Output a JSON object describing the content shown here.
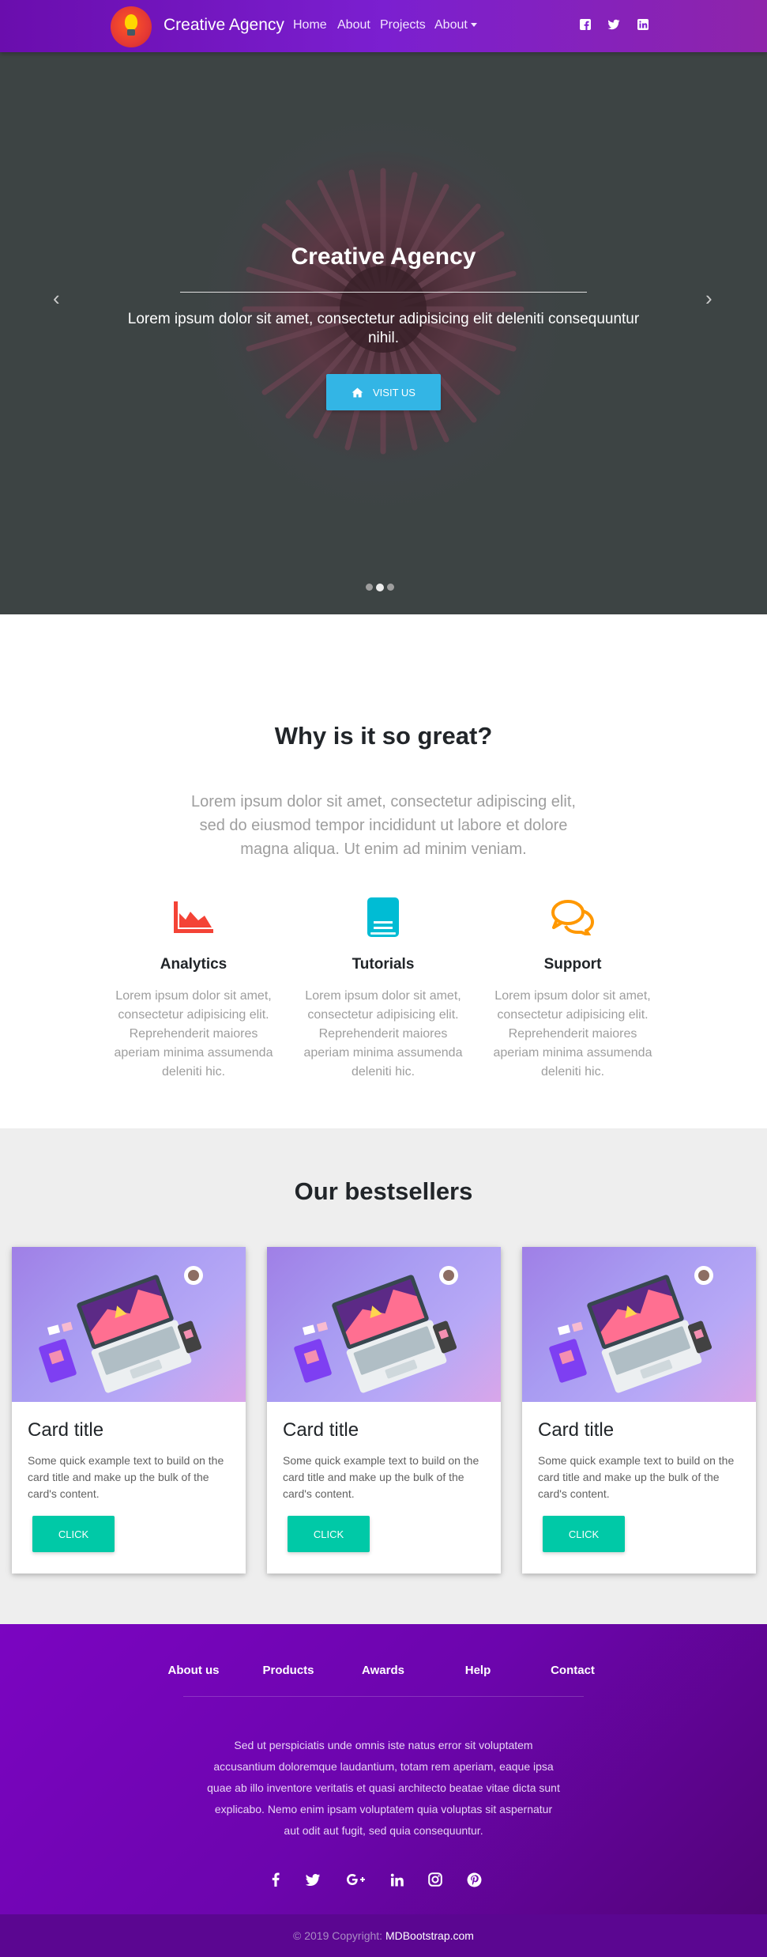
{
  "navbar": {
    "brand": "Creative Agency",
    "links": [
      "Home",
      "About",
      "Projects"
    ],
    "dropdown": "About",
    "social_icons": [
      "facebook-icon",
      "twitter-icon",
      "linkedin-icon"
    ],
    "background": "#7b1fd0"
  },
  "hero": {
    "title": "Creative Agency",
    "text": "Lorem ipsum dolor sit amet, consectetur adipisicing elit deleniti consequuntur nihil.",
    "button": "Visit us",
    "button_icon": "home-icon",
    "button_color": "#33b5e5",
    "slides": 3,
    "active_slide": 2
  },
  "why": {
    "title": "Why is it so great?",
    "lead": "Lorem ipsum dolor sit amet, consectetur adipiscing elit, sed do eiusmod tempor incididunt ut labore et dolore magna aliqua. Ut enim ad minim veniam.",
    "features": [
      {
        "title": "Analytics",
        "icon": "area-chart-icon",
        "color": "#f44336",
        "text": "Lorem ipsum dolor sit amet, consectetur adipisicing elit. Reprehenderit maiores aperiam minima assumenda deleniti hic."
      },
      {
        "title": "Tutorials",
        "icon": "book-icon",
        "color": "#00bcd4",
        "text": "Lorem ipsum dolor sit amet, consectetur adipisicing elit. Reprehenderit maiores aperiam minima assumenda deleniti hic."
      },
      {
        "title": "Support",
        "icon": "comments-icon",
        "color": "#ff9800",
        "text": "Lorem ipsum dolor sit amet, consectetur adipisicing elit. Reprehenderit maiores aperiam minima assumenda deleniti hic."
      }
    ]
  },
  "bestsellers": {
    "title": "Our bestsellers",
    "cards": [
      {
        "title": "Card title",
        "text": "Some quick example text to build on the card title and make up the bulk of the card's content.",
        "button": "CLICK"
      },
      {
        "title": "Card title",
        "text": "Some quick example text to build on the card title and make up the bulk of the card's content.",
        "button": "CLICK"
      },
      {
        "title": "Card title",
        "text": "Some quick example text to build on the card title and make up the bulk of the card's content.",
        "button": "CLICK"
      }
    ],
    "button_color": "#00c9a7"
  },
  "footer": {
    "links": [
      "About us",
      "Products",
      "Awards",
      "Help",
      "Contact"
    ],
    "text": "Sed ut perspiciatis unde omnis iste natus error sit voluptatem accusantium doloremque laudantium, totam rem aperiam, eaque ipsa quae ab illo inventore veritatis et quasi architecto beatae vitae dicta sunt explicabo. Nemo enim ipsam voluptatem quia voluptas sit aspernatur aut odit aut fugit, sed quia consequuntur.",
    "social_icons": [
      "facebook-icon",
      "twitter-icon",
      "google-plus-icon",
      "linkedin-icon",
      "instagram-icon",
      "pinterest-icon"
    ],
    "copyright": "© 2019 Copyright:",
    "copyright_site": "MDBootstrap.com"
  }
}
